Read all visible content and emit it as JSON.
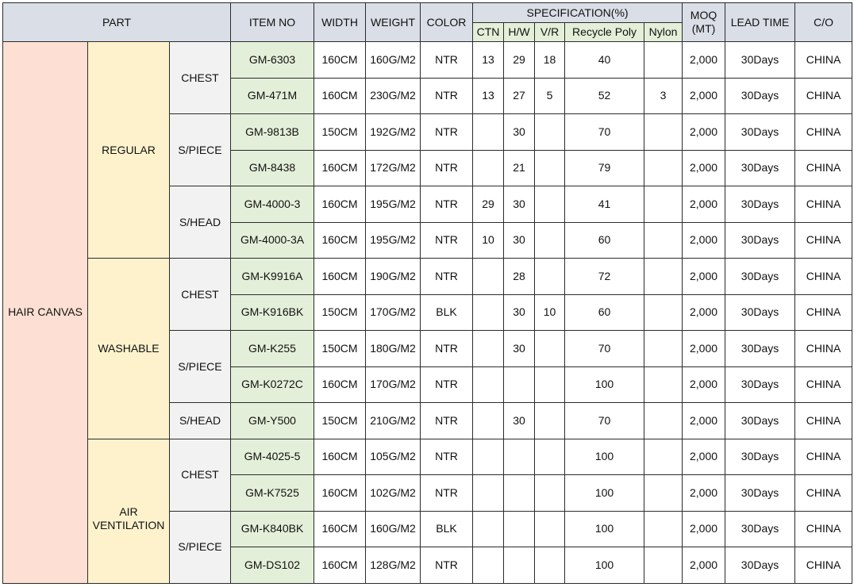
{
  "headers": {
    "part": "PART",
    "item_no": "ITEM NO",
    "width": "WIDTH",
    "weight": "WEIGHT",
    "color": "COLOR",
    "specification": "SPECIFICATION(%)",
    "moq_line1": "MOQ",
    "moq_line2": "(MT)",
    "lead_time": "LEAD TIME",
    "co": "C/O",
    "spec_cols": [
      "CTN",
      "H/W",
      "V/R",
      "Recycle Poly",
      "Nylon"
    ]
  },
  "category": "HAIR CANVAS",
  "groups": [
    {
      "name": "REGULAR",
      "subgroups": [
        {
          "name": "CHEST",
          "rows": [
            {
              "item_no": "GM-6303",
              "width": "160CM",
              "weight": "160G/M2",
              "color": "NTR",
              "ctn": "13",
              "hw": "29",
              "vr": "18",
              "recycle_poly": "40",
              "nylon": "",
              "moq": "2,000",
              "lead_time": "30Days",
              "co": "CHINA"
            },
            {
              "item_no": "GM-471M",
              "width": "160CM",
              "weight": "230G/M2",
              "color": "NTR",
              "ctn": "13",
              "hw": "27",
              "vr": "5",
              "recycle_poly": "52",
              "nylon": "3",
              "moq": "2,000",
              "lead_time": "30Days",
              "co": "CHINA"
            }
          ]
        },
        {
          "name": "S/PIECE",
          "rows": [
            {
              "item_no": "GM-9813B",
              "width": "150CM",
              "weight": "192G/M2",
              "color": "NTR",
              "ctn": "",
              "hw": "30",
              "vr": "",
              "recycle_poly": "70",
              "nylon": "",
              "moq": "2,000",
              "lead_time": "30Days",
              "co": "CHINA"
            },
            {
              "item_no": "GM-8438",
              "width": "160CM",
              "weight": "172G/M2",
              "color": "NTR",
              "ctn": "",
              "hw": "21",
              "vr": "",
              "recycle_poly": "79",
              "nylon": "",
              "moq": "2,000",
              "lead_time": "30Days",
              "co": "CHINA"
            }
          ]
        },
        {
          "name": "S/HEAD",
          "rows": [
            {
              "item_no": "GM-4000-3",
              "width": "160CM",
              "weight": "195G/M2",
              "color": "NTR",
              "ctn": "29",
              "hw": "30",
              "vr": "",
              "recycle_poly": "41",
              "nylon": "",
              "moq": "2,000",
              "lead_time": "30Days",
              "co": "CHINA"
            },
            {
              "item_no": "GM-4000-3A",
              "width": "160CM",
              "weight": "195G/M2",
              "color": "NTR",
              "ctn": "10",
              "hw": "30",
              "vr": "",
              "recycle_poly": "60",
              "nylon": "",
              "moq": "2,000",
              "lead_time": "30Days",
              "co": "CHINA"
            }
          ]
        }
      ]
    },
    {
      "name": "WASHABLE",
      "subgroups": [
        {
          "name": "CHEST",
          "rows": [
            {
              "item_no": "GM-K9916A",
              "width": "160CM",
              "weight": "190G/M2",
              "color": "NTR",
              "ctn": "",
              "hw": "28",
              "vr": "",
              "recycle_poly": "72",
              "nylon": "",
              "moq": "2,000",
              "lead_time": "30Days",
              "co": "CHINA"
            },
            {
              "item_no": "GM-K916BK",
              "width": "150CM",
              "weight": "170G/M2",
              "color": "BLK",
              "ctn": "",
              "hw": "30",
              "vr": "10",
              "recycle_poly": "60",
              "nylon": "",
              "moq": "2,000",
              "lead_time": "30Days",
              "co": "CHINA"
            }
          ]
        },
        {
          "name": "S/PIECE",
          "rows": [
            {
              "item_no": "GM-K255",
              "width": "150CM",
              "weight": "180G/M2",
              "color": "NTR",
              "ctn": "",
              "hw": "30",
              "vr": "",
              "recycle_poly": "70",
              "nylon": "",
              "moq": "2,000",
              "lead_time": "30Days",
              "co": "CHINA"
            },
            {
              "item_no": "GM-K0272C",
              "width": "160CM",
              "weight": "170G/M2",
              "color": "NTR",
              "ctn": "",
              "hw": "",
              "vr": "",
              "recycle_poly": "100",
              "nylon": "",
              "moq": "2,000",
              "lead_time": "30Days",
              "co": "CHINA"
            }
          ]
        },
        {
          "name": "S/HEAD",
          "rows": [
            {
              "item_no": "GM-Y500",
              "width": "150CM",
              "weight": "210G/M2",
              "color": "NTR",
              "ctn": "",
              "hw": "30",
              "vr": "",
              "recycle_poly": "70",
              "nylon": "",
              "moq": "2,000",
              "lead_time": "30Days",
              "co": "CHINA"
            }
          ]
        }
      ]
    },
    {
      "name": "AIR VENTILATION",
      "name_line1": "AIR",
      "name_line2": "VENTILATION",
      "subgroups": [
        {
          "name": "CHEST",
          "rows": [
            {
              "item_no": "GM-4025-5",
              "width": "160CM",
              "weight": "105G/M2",
              "color": "NTR",
              "ctn": "",
              "hw": "",
              "vr": "",
              "recycle_poly": "100",
              "nylon": "",
              "moq": "2,000",
              "lead_time": "30Days",
              "co": "CHINA"
            },
            {
              "item_no": "GM-K7525",
              "width": "160CM",
              "weight": "102G/M2",
              "color": "NTR",
              "ctn": "",
              "hw": "",
              "vr": "",
              "recycle_poly": "100",
              "nylon": "",
              "moq": "2,000",
              "lead_time": "30Days",
              "co": "CHINA"
            }
          ]
        },
        {
          "name": "S/PIECE",
          "rows": [
            {
              "item_no": "GM-K840BK",
              "width": "160CM",
              "weight": "160G/M2",
              "color": "BLK",
              "ctn": "",
              "hw": "",
              "vr": "",
              "recycle_poly": "100",
              "nylon": "",
              "moq": "2,000",
              "lead_time": "30Days",
              "co": "CHINA"
            },
            {
              "item_no": "GM-DS102",
              "width": "160CM",
              "weight": "128G/M2",
              "color": "NTR",
              "ctn": "",
              "hw": "",
              "vr": "",
              "recycle_poly": "100",
              "nylon": "",
              "moq": "2,000",
              "lead_time": "30Days",
              "co": "CHINA"
            }
          ]
        }
      ]
    }
  ],
  "colors": {
    "header_bg": "#d9dee7",
    "category_bg": "#fde0d3",
    "group_bg": "#fef2cd",
    "subgroup_bg": "#f2f2f2",
    "item_bg": "#e4efd9",
    "border": "#2b2b2b"
  }
}
